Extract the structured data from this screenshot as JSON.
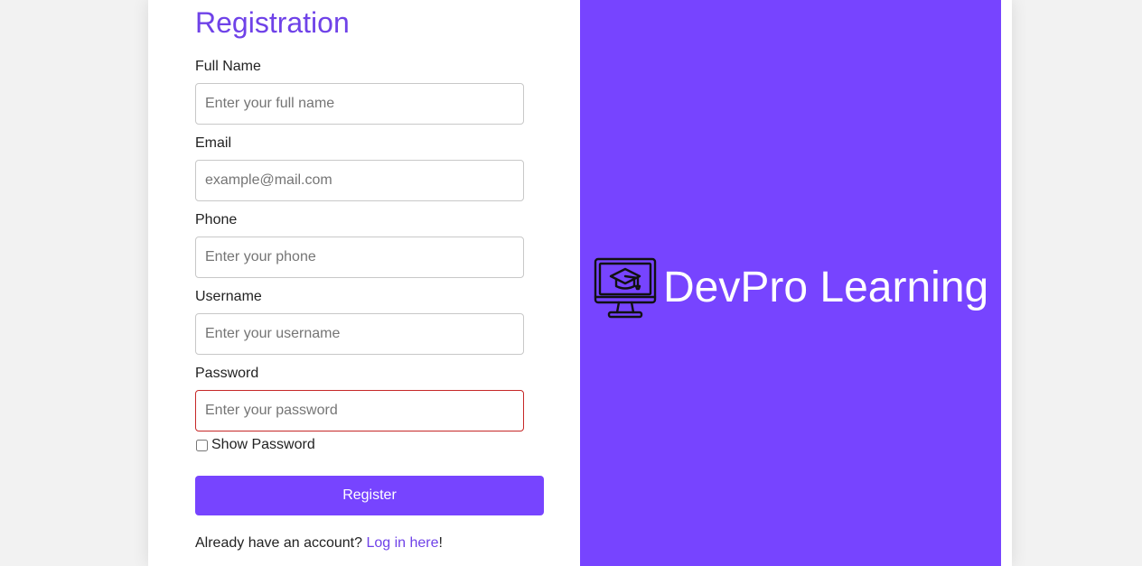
{
  "form": {
    "title": "Registration",
    "fields": [
      {
        "label": "Full Name",
        "placeholder": "Enter your full name",
        "value": ""
      },
      {
        "label": "Email",
        "placeholder": "example@mail.com",
        "value": ""
      },
      {
        "label": "Phone",
        "placeholder": "Enter your phone",
        "value": ""
      },
      {
        "label": "Username",
        "placeholder": "Enter your username",
        "value": ""
      },
      {
        "label": "Password",
        "placeholder": "Enter your password",
        "value": ""
      }
    ],
    "show_password_label": "Show Password",
    "show_password_checked": false,
    "register_label": "Register",
    "login_prompt": "Already have an account? ",
    "login_link": "Log in here",
    "login_suffix": "!"
  },
  "brand": {
    "name": "DevPro Learning",
    "icon": "monitor-graduation-cap-icon"
  },
  "colors": {
    "accent": "#7744ff",
    "title": "#6f42e8",
    "error_border": "#c62828",
    "page_bg": "#f2f2f2"
  }
}
